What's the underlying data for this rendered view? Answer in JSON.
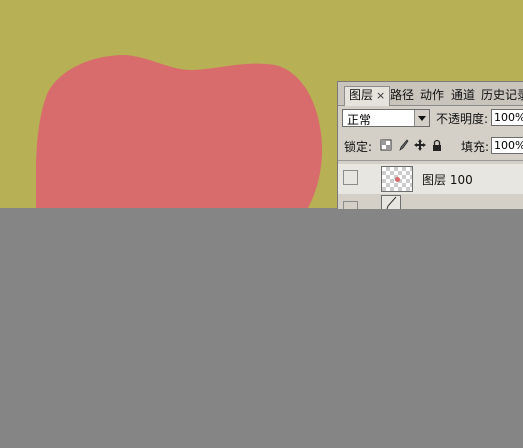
{
  "canvas": {
    "background": "#b7b054",
    "shape_color": "#d86c6c"
  },
  "layers_panel": {
    "tabs": [
      {
        "label": "图层",
        "active": true,
        "close": "×"
      },
      {
        "label": "路径"
      },
      {
        "label": "动作"
      },
      {
        "label": "通道"
      },
      {
        "label": "历史记录"
      }
    ],
    "blend_mode": "正常",
    "opacity_label": "不透明度:",
    "opacity_value": "100%",
    "lock_label": "锁定:",
    "fill_label": "填充:",
    "fill_value": "100%",
    "layer_name": "图层 100"
  }
}
